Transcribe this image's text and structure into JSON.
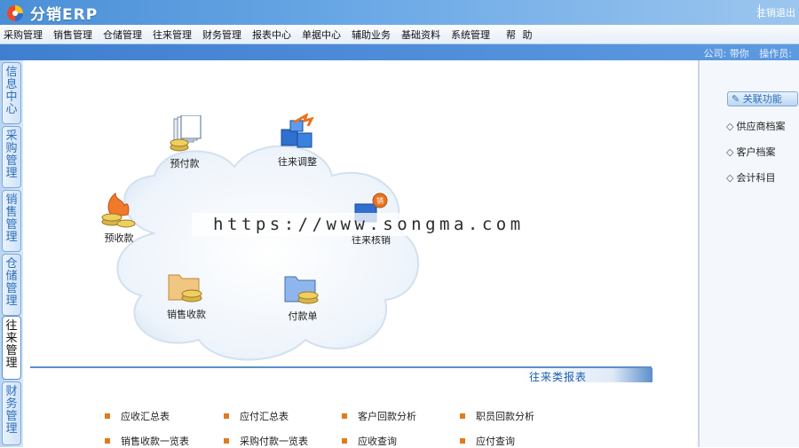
{
  "header": {
    "app_title": "分销ERP",
    "logout_label": "注销退出",
    "colors": {
      "header_start": "#4a8fd6",
      "header_end": "#9cc6ef",
      "accent": "#e07a1f"
    }
  },
  "menu": {
    "items": [
      "采购管理",
      "销售管理",
      "仓储管理",
      "往来管理",
      "财务管理",
      "报表中心",
      "单据中心",
      "辅助业务",
      "基础资料",
      "系统管理"
    ],
    "help_label": "帮 助"
  },
  "info_bar": {
    "company_label": "公司: 带你",
    "operator_label": "操作员:"
  },
  "left_tabs": [
    {
      "label": "信息中心",
      "active": false
    },
    {
      "label": "采购管理",
      "active": false
    },
    {
      "label": "销售管理",
      "active": false
    },
    {
      "label": "仓储管理",
      "active": false
    },
    {
      "label": "往来管理",
      "active": true
    },
    {
      "label": "财务管理",
      "active": false
    }
  ],
  "flow": {
    "nodes": [
      {
        "label": "预付款",
        "icon": "documents-coins-icon"
      },
      {
        "label": "往来调整",
        "icon": "blocks-arrow-icon"
      },
      {
        "label": "预收款",
        "icon": "fire-coins-icon"
      },
      {
        "label": "往来核销",
        "icon": "sales-box-icon"
      },
      {
        "label": "销售收款",
        "icon": "folder-coins-icon"
      },
      {
        "label": "付款单",
        "icon": "blue-folder-coins-icon"
      }
    ]
  },
  "watermark": "https://www.songma.com",
  "reports": {
    "title": "往来类报表",
    "items": [
      "应收汇总表",
      "应付汇总表",
      "客户回款分析",
      "职员回款分析",
      "销售收款一览表",
      "采购付款一览表",
      "应收查询",
      "应付查询"
    ]
  },
  "related": {
    "button_label": "✎ 关联功能",
    "items": [
      "供应商档案",
      "客户档案",
      "会计科目"
    ]
  }
}
